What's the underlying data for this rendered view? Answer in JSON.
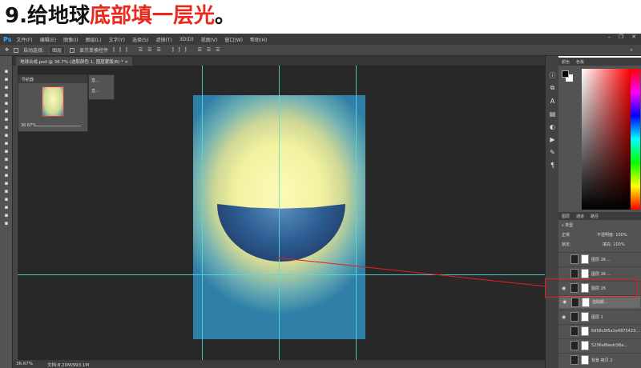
{
  "title": {
    "prefix": "9.给地球",
    "highlight": "底部填一层光",
    "suffix": "。"
  },
  "colors": {
    "accent": "#e8291c",
    "ps_blue": "#31a8ff"
  },
  "app": {
    "logo": "Ps"
  },
  "menu": [
    "文件(F)",
    "编辑(E)",
    "图像(I)",
    "图层(L)",
    "文字(Y)",
    "选择(S)",
    "滤镜(T)",
    "3D(D)",
    "视图(V)",
    "窗口(W)",
    "帮助(H)"
  ],
  "options": {
    "auto_select": "自动选择:",
    "target": "图层",
    "show_transform": "显示变换控件"
  },
  "tab": {
    "label": "地球合成.psd @ 36.7% (选取颜色 1, 图层蒙版/8) *",
    "close": "×"
  },
  "navigator": {
    "title": "导航器",
    "zoom": "36.67%"
  },
  "mini_panel": {
    "item1": "直...",
    "item2": "直..."
  },
  "status": {
    "zoom": "36.67%",
    "doc": "文档:8.20M/993.1M"
  },
  "color_panel": {
    "tabs": [
      "颜色",
      "色板"
    ]
  },
  "layers_panel": {
    "tabs": [
      "图层",
      "通道",
      "路径"
    ],
    "filter": "类型",
    "blend_mode": "正常",
    "opacity_label": "不透明度:",
    "opacity": "100%",
    "lock_label": "锁定:",
    "fill_label": "填充:",
    "fill": "100%",
    "layers": [
      {
        "name": "图层 26 ...",
        "visible": false,
        "selected": false
      },
      {
        "name": "图层 26 ...",
        "visible": false,
        "selected": false
      },
      {
        "name": "图层 26",
        "visible": true,
        "selected": false
      },
      {
        "name": "选取颜...",
        "visible": true,
        "selected": true
      },
      {
        "name": "图层 1",
        "visible": true,
        "selected": false
      },
      {
        "name": "6d58c0f5a1e4875423...",
        "visible": false,
        "selected": false
      },
      {
        "name": "5236a8bedc96e...",
        "visible": false,
        "selected": false
      },
      {
        "name": "背景 拷贝 2",
        "visible": false,
        "selected": false
      }
    ]
  }
}
